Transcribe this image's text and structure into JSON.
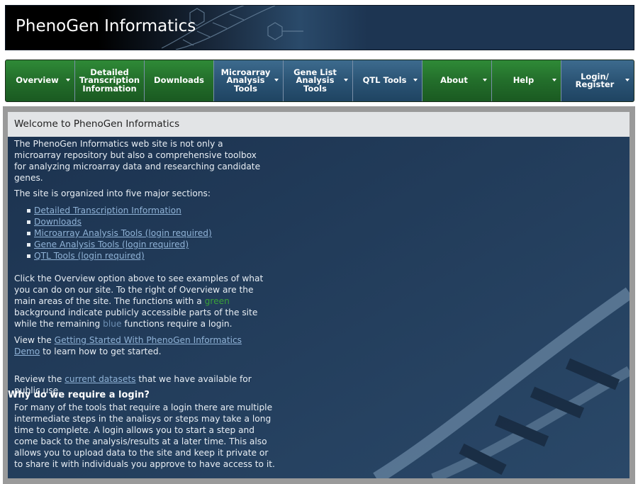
{
  "header": {
    "title": "PhenoGen Informatics"
  },
  "menu": [
    {
      "label": "Overview",
      "color": "green",
      "dropdown": true
    },
    {
      "label": "Detailed Transcription Information",
      "color": "green",
      "dropdown": false
    },
    {
      "label": "Downloads",
      "color": "green",
      "dropdown": false
    },
    {
      "label": "Microarray Analysis Tools",
      "color": "blue",
      "dropdown": true
    },
    {
      "label": "Gene List Analysis Tools",
      "color": "blue",
      "dropdown": true
    },
    {
      "label": "QTL Tools",
      "color": "blue",
      "dropdown": true
    },
    {
      "label": "About",
      "color": "green",
      "dropdown": true
    },
    {
      "label": "Help",
      "color": "green",
      "dropdown": true
    },
    {
      "label": "Login/ Register",
      "color": "blue",
      "dropdown": true
    }
  ],
  "colors": {
    "menu_green": "#236e2b",
    "menu_blue": "#2b5475",
    "panel_bg": "#1c3350",
    "link": "#8fb2d6"
  },
  "panel": {
    "heading": "Welcome to PhenoGen Informatics",
    "intro": "The PhenoGen Informatics web site is not only a microarray repository but also a comprehensive toolbox for analyzing microarray data and researching candidate genes.",
    "sections_intro": "The site is organized into five major sections:",
    "sections": [
      "Detailed Transcription Information",
      "Downloads",
      "Microarray Analysis Tools (login required)",
      "Gene Analysis Tools (login required)",
      "QTL Tools (login required)"
    ],
    "overview_part1": "Click the Overview option above to see examples of what you can do on our site. To the right of Overview are the main areas of the site. The functions with a ",
    "overview_green": "green",
    "overview_part2": " background indicate publicly accessible parts of the site while the remaining ",
    "overview_blue": "blue",
    "overview_part3": " functions require a login.",
    "demo_prefix": "View the ",
    "demo_link": "Getting Started With PhenoGen Informatics Demo",
    "demo_suffix": " to learn how to get started.",
    "datasets_prefix": "Review the ",
    "datasets_link": "current datasets",
    "datasets_suffix": " that we have available for public use.",
    "why_heading": "Why do we require a login?",
    "why_body": "For many of the tools that require a login there are multiple intermediate steps in the analisys or steps may take a long time to complete. A login allows you to start a step and come back to the analysis/results at a later time. This also allows you to upload data to the site and keep it private or to share it with individuals you approve to have access to it."
  }
}
